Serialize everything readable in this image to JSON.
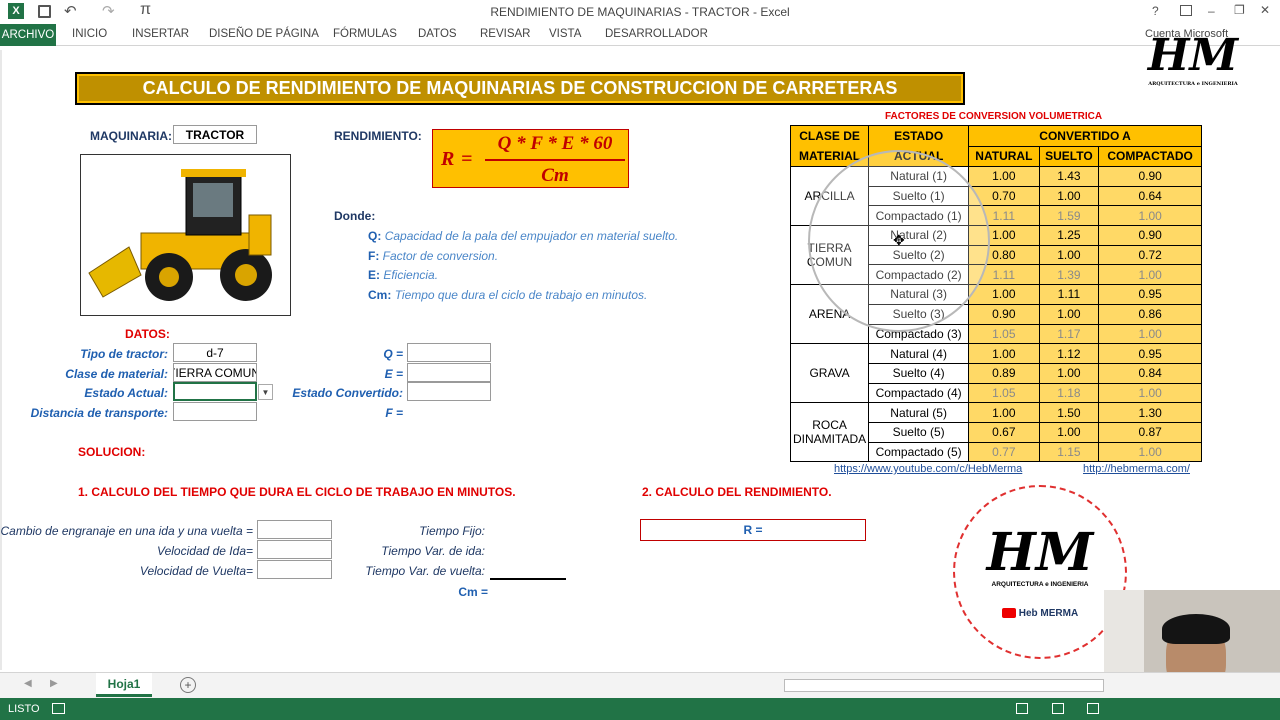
{
  "window": {
    "title": "RENDIMIENTO DE MAQUINARIAS - TRACTOR - Excel",
    "account": "Cuenta Microsoft"
  },
  "ribbon": {
    "tabs": [
      "ARCHIVO",
      "INICIO",
      "INSERTAR",
      "DISEÑO DE PÁGINA",
      "FÓRMULAS",
      "DATOS",
      "REVISAR",
      "VISTA",
      "DESARROLLADOR"
    ]
  },
  "sheet": {
    "main_title": "CALCULO DE RENDIMIENTO DE MAQUINARIAS DE CONSTRUCCION DE CARRETERAS",
    "maquinaria_label": "MAQUINARIA:",
    "maquinaria_value": "TRACTOR",
    "rendimiento_label": "RENDIMIENTO:",
    "formula": {
      "lhs": "R",
      "numerator": "Q * F * E * 60",
      "denominator": "Cm"
    },
    "donde": "Donde:",
    "defs": [
      {
        "k": "Q:",
        "v": "Capacidad de la pala del empujador en material suelto."
      },
      {
        "k": "F:",
        "v": "Factor de conversion."
      },
      {
        "k": "E:",
        "v": "Eficiencia."
      },
      {
        "k": "Cm:",
        "v": "Tiempo que dura el ciclo de trabajo en minutos."
      }
    ],
    "datos": "DATOS:",
    "tipo_label": "Tipo de tractor:",
    "tipo_value": "d-7",
    "clase_label": "Clase de material:",
    "clase_value": "TIERRA COMUN",
    "estado_label": "Estado Actual:",
    "distancia_label": "Distancia de transporte:",
    "q_label": "Q =",
    "e_label": "E =",
    "estado_conv_label": "Estado Convertido:",
    "f_label": "F =",
    "solucion": "SOLUCION:",
    "step1": "1. CALCULO DEL TIEMPO QUE DURA EL CICLO DE TRABAJO EN MINUTOS.",
    "step2": "2. CALCULO DEL RENDIMIENTO.",
    "cambio_label": "Cambio de engranaje en una ida y una vuelta =",
    "vel_ida_label": "Velocidad de Ida=",
    "vel_vuelta_label": "Velocidad de Vuelta=",
    "tfijo_label": "Tiempo Fijo:",
    "tvar_ida_label": "Tiempo Var. de ida:",
    "tvar_vuelta_label": "Tiempo Var. de vuelta:",
    "cm_label": "Cm =",
    "r_label": "R =",
    "factors_title": "FACTORES DE CONVERSION VOLUMETRICA",
    "headers": {
      "clase": "CLASE DE MATERIAL",
      "estado": "ESTADO ACTUAL",
      "convertido": "CONVERTIDO A",
      "natural": "NATURAL",
      "suelto": "SUELTO",
      "compactado": "COMPACTADO"
    },
    "materials": [
      {
        "name": "ARCILLA",
        "rows": [
          [
            "Natural (1)",
            "1.00",
            "1.43",
            "0.90"
          ],
          [
            "Suelto (1)",
            "0.70",
            "1.00",
            "0.64"
          ],
          [
            "Compactado (1)",
            "1.11",
            "1.59",
            "1.00"
          ]
        ]
      },
      {
        "name": "TIERRA COMUN",
        "rows": [
          [
            "Natural (2)",
            "1.00",
            "1.25",
            "0.90"
          ],
          [
            "Suelto (2)",
            "0.80",
            "1.00",
            "0.72"
          ],
          [
            "Compactado (2)",
            "1.11",
            "1.39",
            "1.00"
          ]
        ]
      },
      {
        "name": "ARENA",
        "rows": [
          [
            "Natural (3)",
            "1.00",
            "1.11",
            "0.95"
          ],
          [
            "Suelto (3)",
            "0.90",
            "1.00",
            "0.86"
          ],
          [
            "Compactado (3)",
            "1.05",
            "1.17",
            "1.00"
          ]
        ]
      },
      {
        "name": "GRAVA",
        "rows": [
          [
            "Natural (4)",
            "1.00",
            "1.12",
            "0.95"
          ],
          [
            "Suelto (4)",
            "0.89",
            "1.00",
            "0.84"
          ],
          [
            "Compactado (4)",
            "1.05",
            "1.18",
            "1.00"
          ]
        ]
      },
      {
        "name": "ROCA DINAMITADA",
        "rows": [
          [
            "Natural (5)",
            "1.00",
            "1.50",
            "1.30"
          ],
          [
            "Suelto (5)",
            "0.67",
            "1.00",
            "0.87"
          ],
          [
            "Compactado (5)",
            "0.77",
            "1.15",
            "1.00"
          ]
        ]
      }
    ],
    "link1": "https://www.youtube.com/c/HebMerma",
    "link2": "http://hebmerma.com/",
    "logo_text": "HM",
    "logo_sub": "ARQUITECTURA e INGENIERIA",
    "logo_channel": "Heb MERMA"
  },
  "sheettabs": {
    "active": "Hoja1"
  },
  "status": {
    "text": "LISTO"
  }
}
